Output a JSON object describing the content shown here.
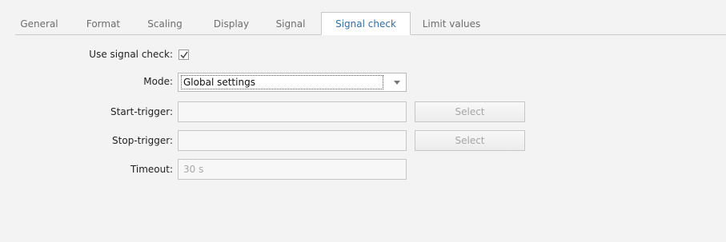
{
  "tabs": [
    {
      "label": "General"
    },
    {
      "label": "Format"
    },
    {
      "label": "Scaling"
    },
    {
      "label": "Display"
    },
    {
      "label": "Signal"
    },
    {
      "label": "Signal check"
    },
    {
      "label": "Limit values"
    }
  ],
  "active_tab": "Signal check",
  "form": {
    "use_signal_check": {
      "label": "Use signal check:",
      "checked": true
    },
    "mode": {
      "label": "Mode:",
      "value": "Global settings"
    },
    "start_trigger": {
      "label": "Start-trigger:",
      "value": "",
      "button": "Select"
    },
    "stop_trigger": {
      "label": "Stop-trigger:",
      "value": "",
      "button": "Select"
    },
    "timeout": {
      "label": "Timeout:",
      "value": "30 s"
    }
  },
  "colors": {
    "active_tab_text": "#2f6fa8",
    "background": "#f3f3f3"
  }
}
